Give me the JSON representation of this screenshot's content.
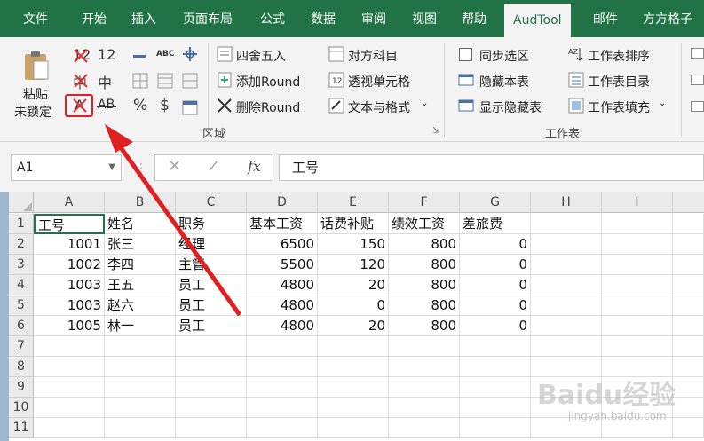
{
  "tabs": [
    {
      "label": "文件"
    },
    {
      "label": "开始"
    },
    {
      "label": "插入"
    },
    {
      "label": "页面布局"
    },
    {
      "label": "公式"
    },
    {
      "label": "数据"
    },
    {
      "label": "审阅"
    },
    {
      "label": "视图"
    },
    {
      "label": "帮助"
    },
    {
      "label": "AudTool"
    },
    {
      "label": "邮件"
    },
    {
      "label": "方方格子"
    }
  ],
  "ribbon": {
    "paste_label": "粘贴",
    "unlock_label": "未锁定",
    "num12_a": "12",
    "num12_b": "12",
    "mid_a": "中",
    "mid_b": "中",
    "text_a": "A",
    "text_ab": "AB",
    "abc": "ABC",
    "percent": "%",
    "dollar": "$",
    "round_half": "四舍五入",
    "add_round": "添加Round",
    "del_round": "删除Round",
    "align_subject": "对方科目",
    "pivot_cell": "透视单元格",
    "text_format": "文本与格式",
    "sync_select": "同步选区",
    "hide_sheet": "隐藏本表",
    "show_hidden": "显示隐藏表",
    "sheet_sort": "工作表排序",
    "sheet_toc": "工作表目录",
    "sheet_fill": "工作表填充",
    "group_region": "区域",
    "group_sheet": "工作表"
  },
  "formula_bar": {
    "cell_ref": "A1",
    "fx": "fx",
    "content": "工号"
  },
  "columns": [
    "A",
    "B",
    "C",
    "D",
    "E",
    "F",
    "G",
    "H",
    "I"
  ],
  "rows": [
    "1",
    "2",
    "3",
    "4",
    "5",
    "6",
    "7",
    "8",
    "9",
    "10",
    "11"
  ],
  "table": {
    "header": [
      "工号",
      "姓名",
      "职务",
      "基本工资",
      "话费补贴",
      "绩效工资",
      "差旅费"
    ],
    "data": [
      [
        "1001",
        "张三",
        "经理",
        "6500",
        "150",
        "800",
        "0"
      ],
      [
        "1002",
        "李四",
        "主管",
        "5500",
        "120",
        "800",
        "0"
      ],
      [
        "1003",
        "王五",
        "员工",
        "4800",
        "20",
        "800",
        "0"
      ],
      [
        "1003",
        "赵六",
        "员工",
        "4800",
        "0",
        "800",
        "0"
      ],
      [
        "1005",
        "林一",
        "员工",
        "4800",
        "20",
        "800",
        "0"
      ]
    ]
  },
  "watermark": "Baidu经验",
  "watermark_url": "jingyan.baidu.com",
  "colors": {
    "excel_green": "#217346",
    "ribbon_bg": "#f3f3f3",
    "annotation_red": "#e02020"
  }
}
